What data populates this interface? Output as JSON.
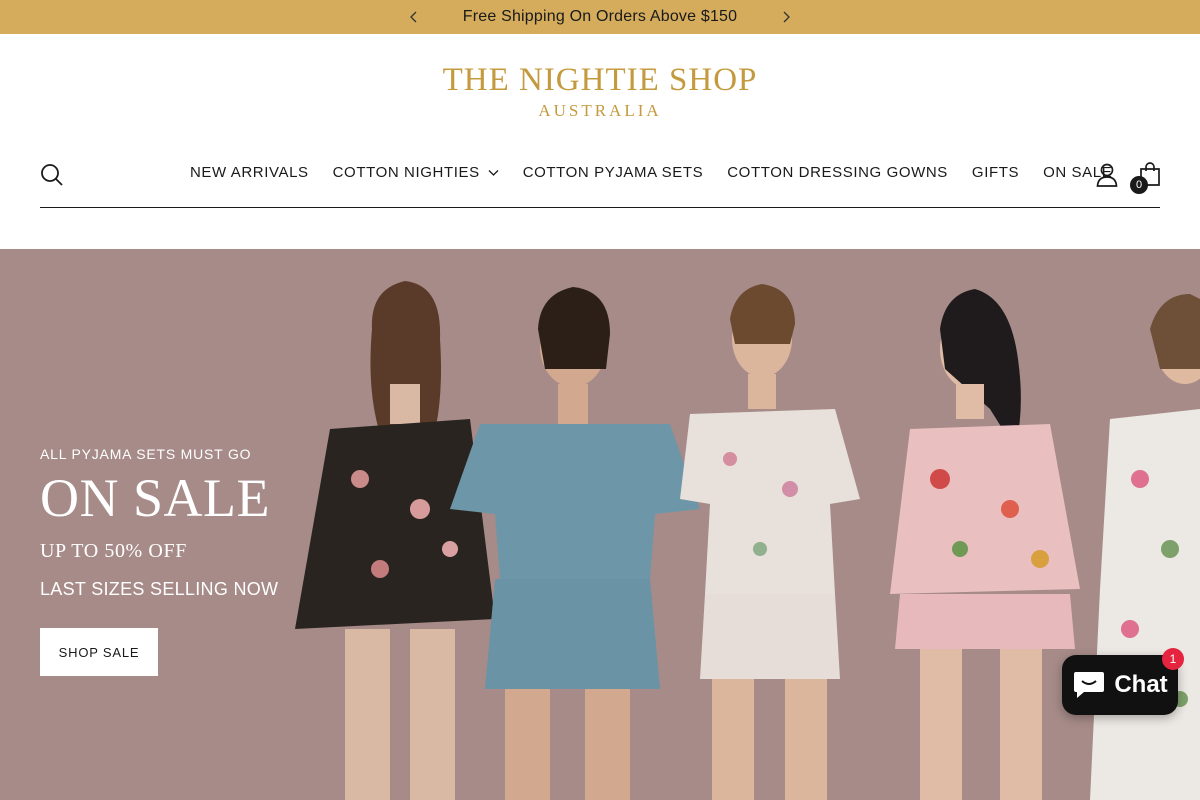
{
  "announcement": {
    "text": "Free Shipping On Orders Above $150"
  },
  "logo": {
    "line1": "THE NIGHTIE SHOP",
    "line2": "AUSTRALIA"
  },
  "nav": {
    "items": [
      {
        "label": "NEW ARRIVALS"
      },
      {
        "label": "COTTON NIGHTIES",
        "has_dropdown": true
      },
      {
        "label": "COTTON PYJAMA SETS"
      },
      {
        "label": "COTTON DRESSING GOWNS"
      },
      {
        "label": "GIFTS"
      },
      {
        "label": "ON SALE"
      }
    ],
    "cart_count": "0",
    "icons": [
      "search-icon",
      "account-icon",
      "cart-icon"
    ]
  },
  "hero": {
    "eyebrow": "ALL PYJAMA SETS MUST GO",
    "headline": "ON SALE",
    "subheading": "UP TO 50% OFF",
    "subtext": "LAST SIZES SELLING NOW",
    "cta_label": "SHOP SALE",
    "background_color": "#a68b88"
  },
  "chat": {
    "label": "Chat",
    "badge": "1"
  },
  "colors": {
    "announcement_bg": "#d4ac5c",
    "logo_gold": "#c49a3e",
    "chat_bg": "#111111",
    "badge_red": "#e5243f"
  }
}
